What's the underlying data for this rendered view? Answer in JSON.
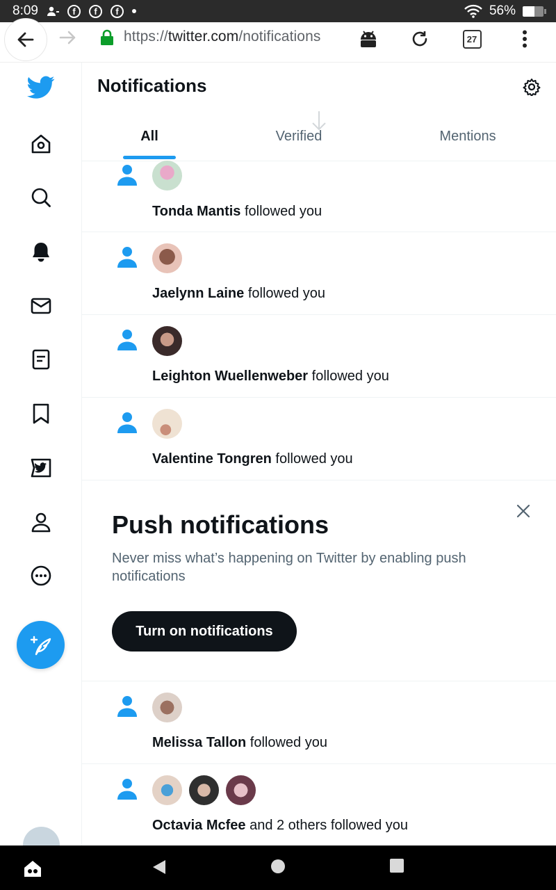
{
  "status_bar": {
    "time": "8:09",
    "battery": "56%"
  },
  "browser": {
    "url_scheme": "https://",
    "url_domain": "twitter.com",
    "url_path": "/notifications",
    "tab_count": "27"
  },
  "header": {
    "title": "Notifications"
  },
  "tabs": [
    {
      "label": "All"
    },
    {
      "label": "Verified"
    },
    {
      "label": "Mentions"
    }
  ],
  "notifications": [
    {
      "name": "Tonda Mantis",
      "action": " followed you"
    },
    {
      "name": "Jaelynn Laine",
      "action": " followed you"
    },
    {
      "name": "Leighton Wuellenweber",
      "action": " followed you"
    },
    {
      "name": "Valentine Tongren",
      "action": " followed you"
    },
    {
      "name": "Melissa Tallon",
      "action": " followed you"
    },
    {
      "name": "Octavia Mcfee",
      "action": " and 2 others followed you"
    }
  ],
  "push_prompt": {
    "title": "Push notifications",
    "description": "Never miss what’s happening on Twitter by enabling push notifications",
    "button": "Turn on notifications"
  },
  "colors": {
    "accent": "#1d9bf0",
    "text": "#0f1419",
    "secondary": "#536471"
  }
}
